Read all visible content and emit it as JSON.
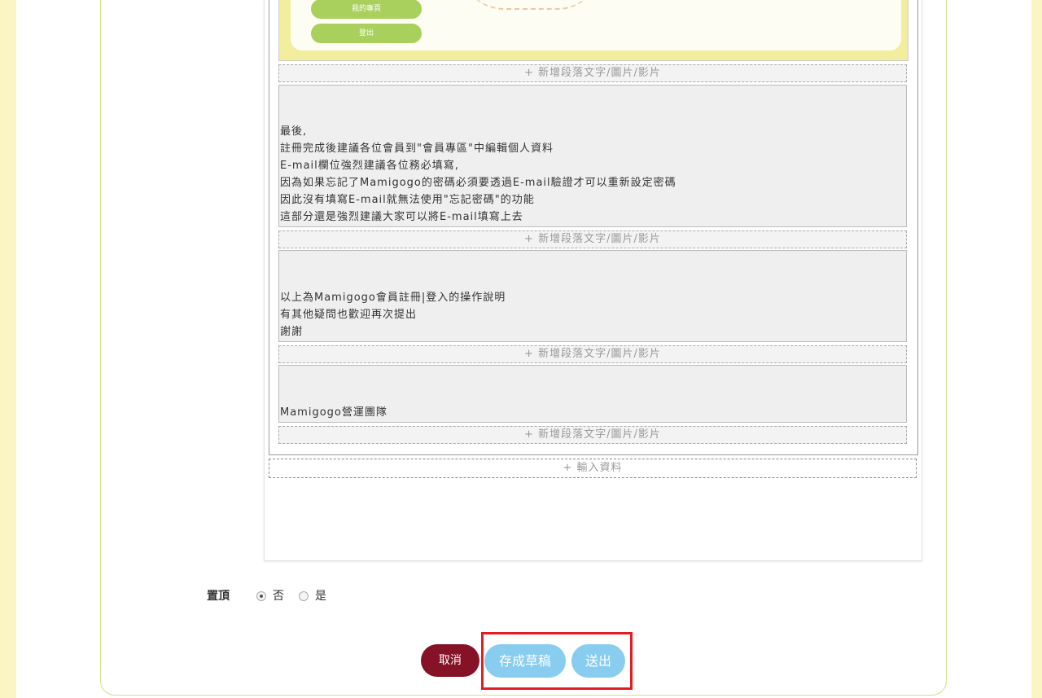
{
  "preview": {
    "menu_items": [
      "我的專頁",
      "登出"
    ]
  },
  "add_paragraph_label": "+ 新增段落文字/圖片/影片",
  "blocks": [
    {
      "lines": [
        "最後,",
        "註冊完成後建議各位會員到\"會員專區\"中編輯個人資料",
        "E-mail欄位強烈建議各位務必填寫,",
        "因為如果忘記了Mamigogo的密碼必須要透過E-mail驗證才可以重新設定密碼",
        "因此沒有填寫E-mail就無法使用\"忘記密碼\"的功能",
        "這部分還是強烈建議大家可以將E-mail填寫上去"
      ]
    },
    {
      "lines": [
        "以上為Mamigogo會員註冊|登入的操作說明",
        "有其他疑問也歡迎再次提出",
        "謝謝"
      ]
    },
    {
      "lines": [
        "Mamigogo營運團隊"
      ]
    }
  ],
  "input_data_label": "+ 輸入資料",
  "pin": {
    "label": "置頂",
    "options": [
      {
        "label": "否",
        "checked": true
      },
      {
        "label": "是",
        "checked": false
      }
    ]
  },
  "buttons": {
    "cancel": "取消",
    "save_draft": "存成草稿",
    "submit": "送出"
  },
  "colors": {
    "page_background": "#fbf5c4",
    "cancel_button": "#861227",
    "primary_button": "#88ccef",
    "highlight": "#e31c23",
    "menu_pill": "#a9cf5c"
  }
}
